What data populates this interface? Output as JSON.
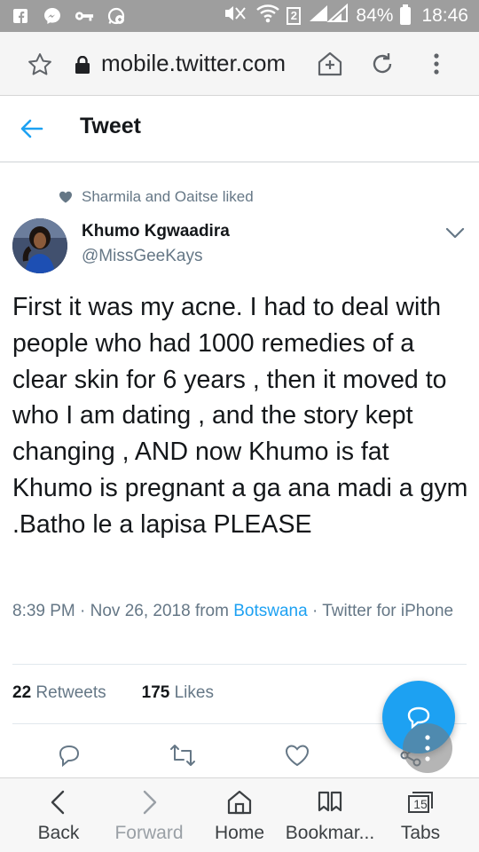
{
  "status_bar": {
    "sim_slot": "2",
    "battery": "84%",
    "time": "18:46",
    "icons": [
      "facebook-icon",
      "messenger-icon",
      "vpn-key-icon",
      "whatsapp-icon",
      "mute-icon",
      "wifi-icon",
      "signal-icon",
      "battery-icon"
    ]
  },
  "browser": {
    "url": "mobile.twitter.com",
    "icons": [
      "star-icon",
      "lock-icon",
      "home-add-icon",
      "reload-icon",
      "menu-icon"
    ]
  },
  "header": {
    "title": "Tweet"
  },
  "tweet": {
    "social_context": "Sharmila and Oaitse liked",
    "author_name": "Khumo Kgwaadira",
    "author_handle": "@MissGeeKays",
    "text": "First it was my acne. I had to deal with people who had 1000 remedies of a clear skin for 6 years , then it moved to who I am dating , and the story kept changing , AND now Khumo is fat Khumo is pregnant a ga ana madi a gym .Batho le a lapisa PLEASE",
    "timestamp": "8:39 PM · Nov 26, 2018 from ",
    "location": "Botswana",
    "source": " · Twitter for iPhone",
    "retweets_count": "22",
    "retweets_label": "Retweets",
    "likes_count": "175",
    "likes_label": "Likes"
  },
  "colors": {
    "accent": "#1da1f2",
    "muted": "#657786",
    "status_bar": "#9e9e9e"
  },
  "bottom_nav": {
    "back": "Back",
    "forward": "Forward",
    "home": "Home",
    "bookmarks": "Bookmar...",
    "tabs": "Tabs",
    "tabs_count": "15"
  }
}
